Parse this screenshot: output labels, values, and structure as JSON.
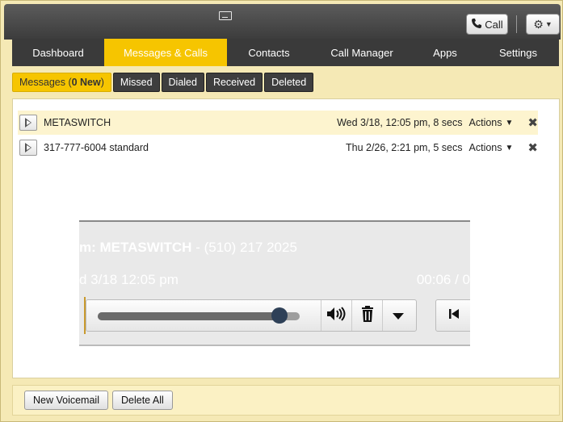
{
  "header": {
    "call_label": "Call"
  },
  "nav": {
    "tabs": [
      {
        "label": "Dashboard"
      },
      {
        "label": "Messages & Calls"
      },
      {
        "label": "Contacts"
      },
      {
        "label": "Call Manager"
      },
      {
        "label": "Apps"
      },
      {
        "label": "Settings"
      }
    ],
    "active": "Messages & Calls"
  },
  "subtabs": {
    "messages_prefix": "Messages (",
    "messages_count": "0 New",
    "messages_suffix": ")",
    "missed": "Missed",
    "dialed": "Dialed",
    "received": "Received",
    "deleted": "Deleted"
  },
  "messages": [
    {
      "name": "METASWITCH",
      "meta": "Wed 3/18, 12:05 pm, 8 secs",
      "actions": "Actions"
    },
    {
      "name": "317-777-6004 standard",
      "meta": "Thu 2/26, 2:21 pm, 5 secs",
      "actions": "Actions"
    }
  ],
  "player": {
    "from_prefix": "m:",
    "from_name": "METASWITCH",
    "from_number": "- (510) 217 2025",
    "date": "d 3/18 12:05 pm",
    "time": "00:06 / 0",
    "progress": 0.9
  },
  "footer": {
    "new_voicemail": "New Voicemail",
    "delete_all": "Delete All"
  },
  "colors": {
    "accent": "#f6c500",
    "nav_bg": "#3a3a3a",
    "frame_bg": "#f5e9b5"
  }
}
